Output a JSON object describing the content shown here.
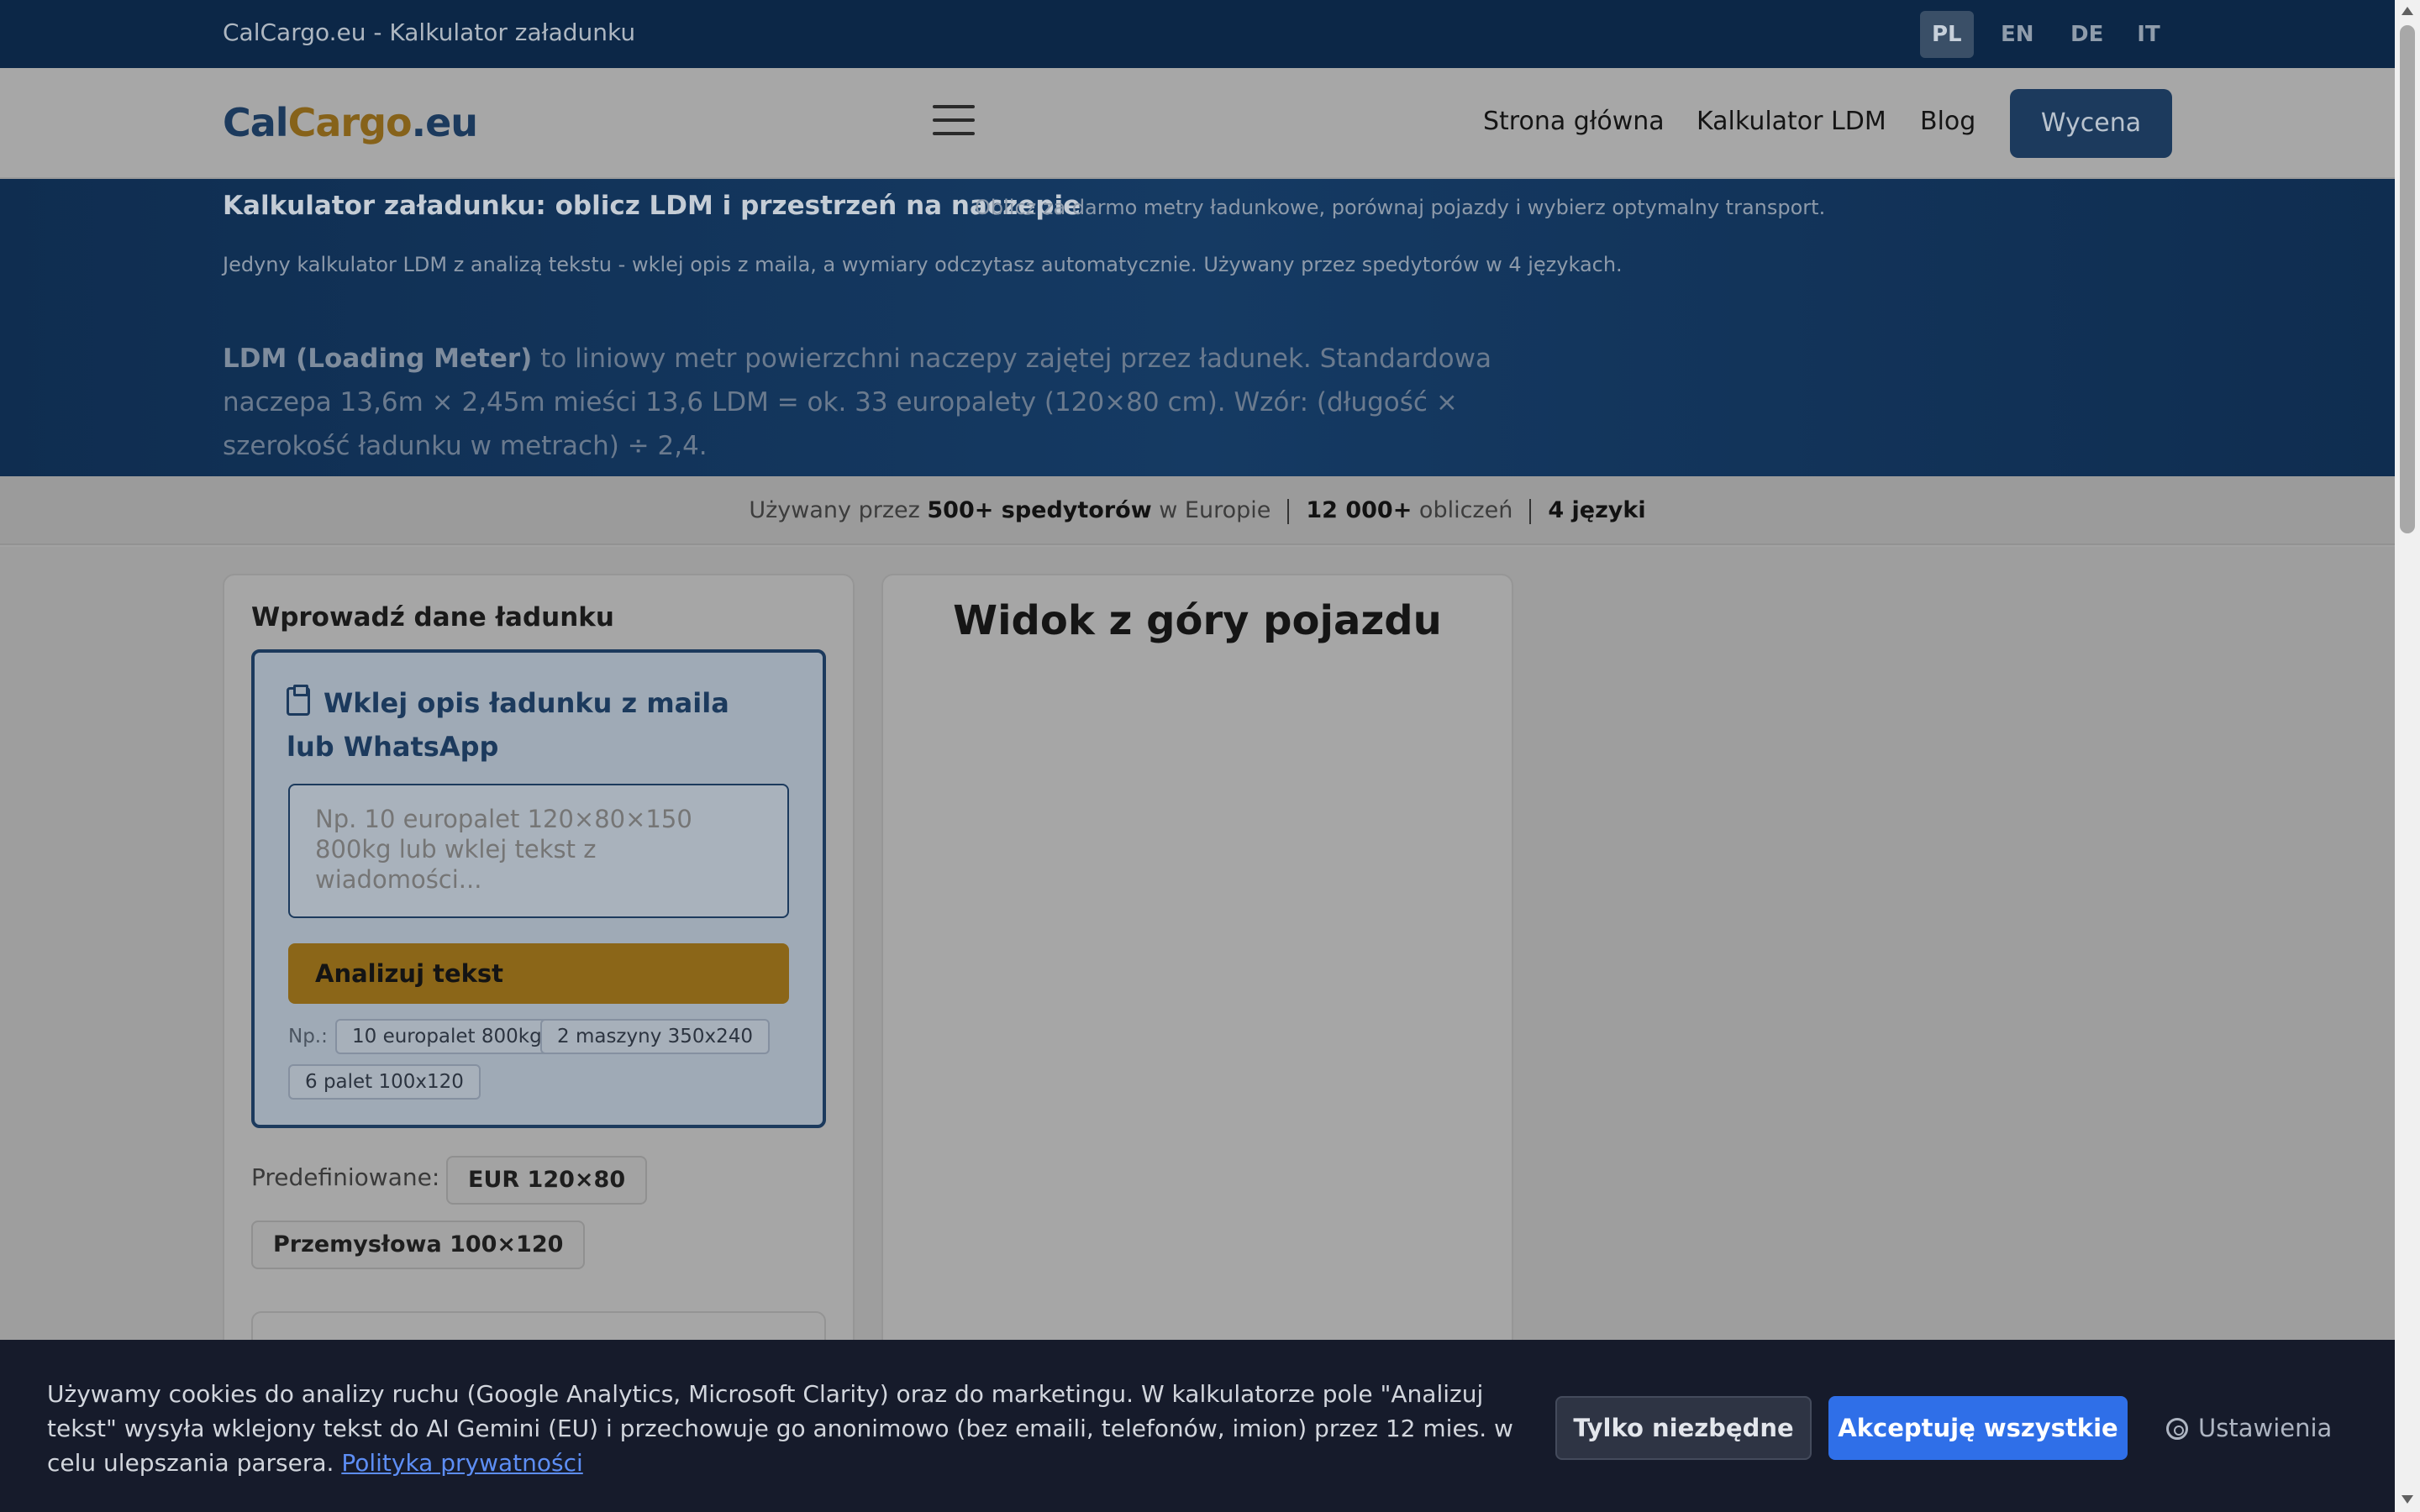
{
  "topbar": {
    "title": "CalCargo.eu - Kalkulator załadunku",
    "languages": [
      "PL",
      "EN",
      "DE",
      "IT"
    ],
    "active_language": "PL"
  },
  "header": {
    "logo": {
      "part1": "Cal",
      "part2": "Cargo",
      "part3": ".eu"
    },
    "nav": [
      "Strona główna",
      "Kalkulator LDM",
      "Blog"
    ],
    "cta": "Wycena"
  },
  "hero": {
    "title": "Kalkulator załadunku: oblicz LDM i przestrzeń na naczepie",
    "subtitle": "Oblicz za darmo metry ładunkowe, porównaj pojazdy i wybierz optymalny transport.",
    "tagline": "Jedyny kalkulator LDM z analizą tekstu - wklej opis z maila, a wymiary odczytasz automatycznie. Używany przez spedytorów w 4 językach.",
    "ldm_term": "LDM (Loading Meter)",
    "ldm_text": " to liniowy metr powierzchni naczepy zajętej przez ładunek. Standardowa naczepa 13,6m × 2,45m mieści 13,6 LDM = ok. 33 europalety (120×80 cm). Wzór: (długość × szerokość ładunku w metrach) ÷ 2,4."
  },
  "stats": {
    "prefix": "Używany przez ",
    "forwarders": "500+ spedytorów",
    "forwarders_suffix": " w Europie",
    "calculations": "12 000+",
    "calculations_suffix": " obliczeń",
    "languages": "4 języki"
  },
  "input_card": {
    "heading": "Wprowadź dane ładunku",
    "paste_title": "Wklej opis ładunku z maila lub WhatsApp",
    "paste_placeholder": "Np. 10 europalet 120×80×150 800kg lub wklej tekst z wiadomości...",
    "analyze_button": "Analizuj tekst",
    "examples_label": "Np.:",
    "examples": [
      "10 europalet 800kg",
      "2 maszyny 350x240",
      "6 palet 100x120"
    ],
    "predefined_label": "Predefiniowane:",
    "predefined": [
      "EUR 120×80",
      "Przemysłowa 100×120"
    ]
  },
  "view_card": {
    "heading": "Widok z góry pojazdu"
  },
  "cookie": {
    "text": "Używamy cookies do analizy ruchu (Google Analytics, Microsoft Clarity) oraz do marketingu. W kalkulatorze pole \"Analizuj tekst\" wysyła wklejony tekst do AI Gemini (EU) i przechowuje go anonimowo (bez emaili, telefonów, imion) przez 12 mies. w celu ulepszania parsera. ",
    "link": "Polityka prywatności",
    "necessary_button": "Tylko niezbędne",
    "accept_button": "Akceptuję wszystkie",
    "settings_button": "Ustawienia"
  }
}
